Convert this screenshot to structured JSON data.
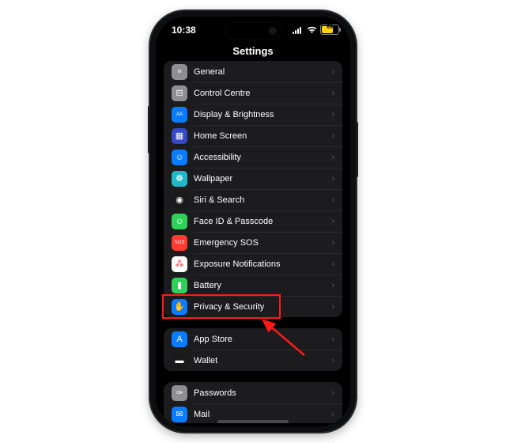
{
  "statusbar": {
    "time": "10:38",
    "battery_text": "69"
  },
  "header": {
    "title": "Settings"
  },
  "groups": [
    {
      "items": [
        {
          "name": "general",
          "label": "General",
          "icon": "gear-icon",
          "bg": "#8e8e93",
          "glyph": "⚙︎"
        },
        {
          "name": "control-centre",
          "label": "Control Centre",
          "icon": "sliders-icon",
          "bg": "#8e8e93",
          "glyph": "⊟"
        },
        {
          "name": "display-brightness",
          "label": "Display & Brightness",
          "icon": "aa-icon",
          "bg": "#0a7cff",
          "glyph": "AA"
        },
        {
          "name": "home-screen",
          "label": "Home Screen",
          "icon": "grid-icon",
          "bg": "#3548c7",
          "glyph": "▦"
        },
        {
          "name": "accessibility",
          "label": "Accessibility",
          "icon": "person-icon",
          "bg": "#0a7cff",
          "glyph": "☺"
        },
        {
          "name": "wallpaper",
          "label": "Wallpaper",
          "icon": "flower-icon",
          "bg": "#20b8c7",
          "glyph": "❁"
        },
        {
          "name": "siri-search",
          "label": "Siri & Search",
          "icon": "siri-icon",
          "bg": "#1a1a1a",
          "glyph": "◉"
        },
        {
          "name": "face-id-passcode",
          "label": "Face ID & Passcode",
          "icon": "faceid-icon",
          "bg": "#30d158",
          "glyph": "☺"
        },
        {
          "name": "emergency-sos",
          "label": "Emergency SOS",
          "icon": "sos-icon",
          "bg": "#ff3b30",
          "glyph": "SOS"
        },
        {
          "name": "exposure-notif",
          "label": "Exposure Notifications",
          "icon": "exposure-icon",
          "bg": "#ffffff",
          "glyph": "⁂",
          "fg": "#ff3b30"
        },
        {
          "name": "battery",
          "label": "Battery",
          "icon": "battery-icon",
          "bg": "#30d158",
          "glyph": "▮"
        },
        {
          "name": "privacy-security",
          "label": "Privacy & Security",
          "icon": "hand-icon",
          "bg": "#0a7cff",
          "glyph": "✋",
          "highlighted": true
        }
      ]
    },
    {
      "items": [
        {
          "name": "app-store",
          "label": "App Store",
          "icon": "appstore-icon",
          "bg": "#0a7cff",
          "glyph": "A"
        },
        {
          "name": "wallet",
          "label": "Wallet",
          "icon": "wallet-icon",
          "bg": "#1a1a1a",
          "glyph": "▬"
        }
      ]
    },
    {
      "items": [
        {
          "name": "passwords",
          "label": "Passwords",
          "icon": "key-icon",
          "bg": "#8e8e93",
          "glyph": "✑"
        },
        {
          "name": "mail",
          "label": "Mail",
          "icon": "mail-icon",
          "bg": "#0a7cff",
          "glyph": "✉"
        }
      ]
    }
  ],
  "chevron": "›"
}
